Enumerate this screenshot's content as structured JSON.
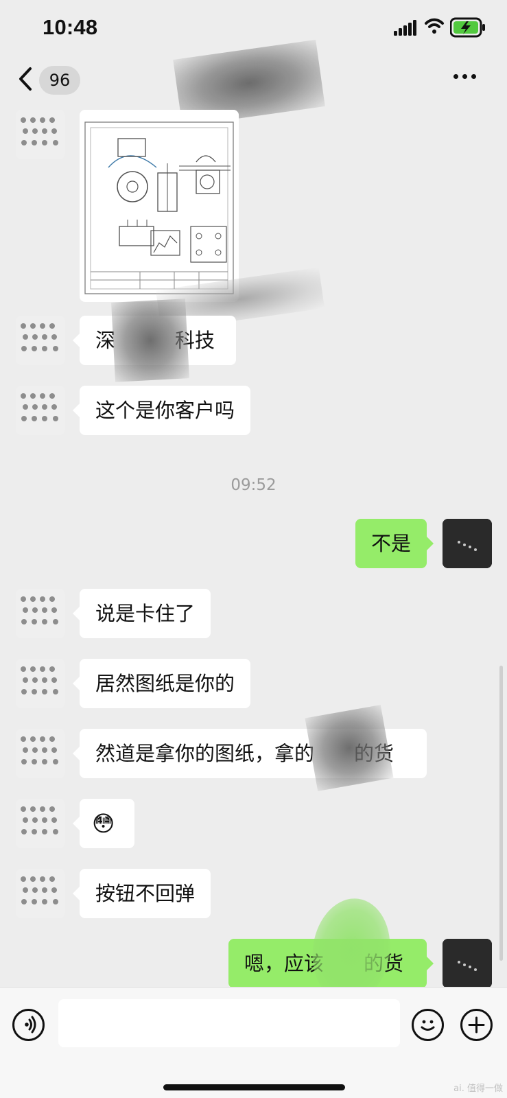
{
  "status_bar": {
    "time": "10:48",
    "icons": [
      "signal-icon",
      "wifi-icon",
      "battery-charging-icon"
    ]
  },
  "nav": {
    "back_icon": "chevron-left-icon",
    "unread_count": "96",
    "more_icon": "more-horizontal-icon"
  },
  "chat": {
    "messages": [
      {
        "side": "left",
        "type": "image",
        "content": "engineering-drawing-image"
      },
      {
        "side": "left",
        "type": "text",
        "text": "深　　　科技"
      },
      {
        "side": "left",
        "type": "text",
        "text": "这个是你客户吗"
      },
      {
        "type": "timestamp",
        "text": "09:52"
      },
      {
        "side": "right",
        "type": "text",
        "text": "不是"
      },
      {
        "side": "left",
        "type": "text",
        "text": "说是卡住了"
      },
      {
        "side": "left",
        "type": "text",
        "text": "居然图纸是你的"
      },
      {
        "side": "left",
        "type": "text",
        "text": "然道是拿你的图纸，拿的　　的货"
      },
      {
        "side": "left",
        "type": "emoji",
        "text": "😳",
        "icon": "embarrassed-emoji-icon"
      },
      {
        "side": "left",
        "type": "text",
        "text": "按钮不回弹"
      },
      {
        "side": "right",
        "type": "text",
        "text": "嗯，应该　　的货"
      }
    ]
  },
  "input": {
    "placeholder": "",
    "voice_icon": "voice-icon",
    "emoji_icon": "smile-icon",
    "add_icon": "plus-icon"
  },
  "watermark": {
    "text": "ai. 值得一做"
  }
}
